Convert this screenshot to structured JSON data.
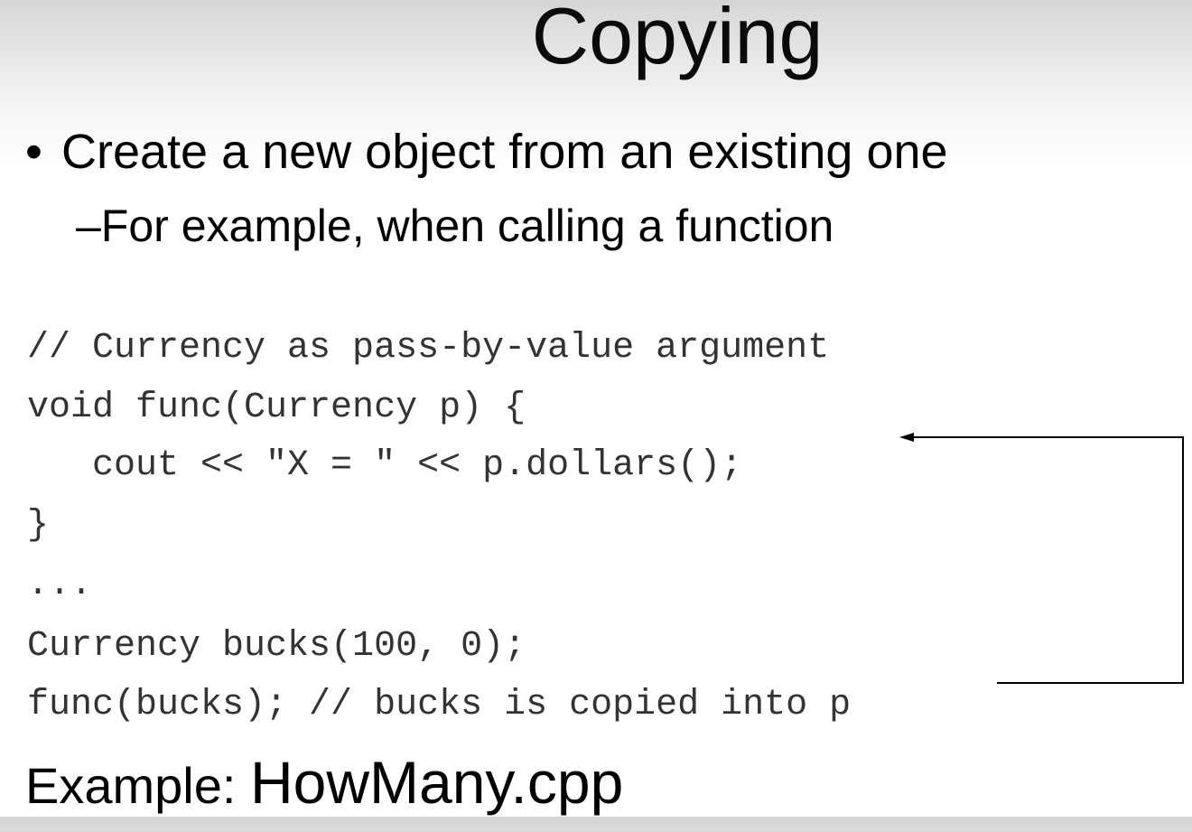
{
  "slide": {
    "title": "Copying",
    "bullet": {
      "marker": "•",
      "text": "Create a new object from an existing one"
    },
    "sub_bullet": {
      "text": "–For example, when calling a function"
    },
    "code_lines": [
      "// Currency as pass-by-value argument",
      "void func(Currency p) {",
      "   cout << \"X = \" << p.dollars();",
      "}",
      "...",
      "Currency bucks(100, 0);",
      "func(bucks); // bucks is copied into p"
    ],
    "example": {
      "label": "Example: ",
      "file": "HowMany.cpp"
    }
  }
}
